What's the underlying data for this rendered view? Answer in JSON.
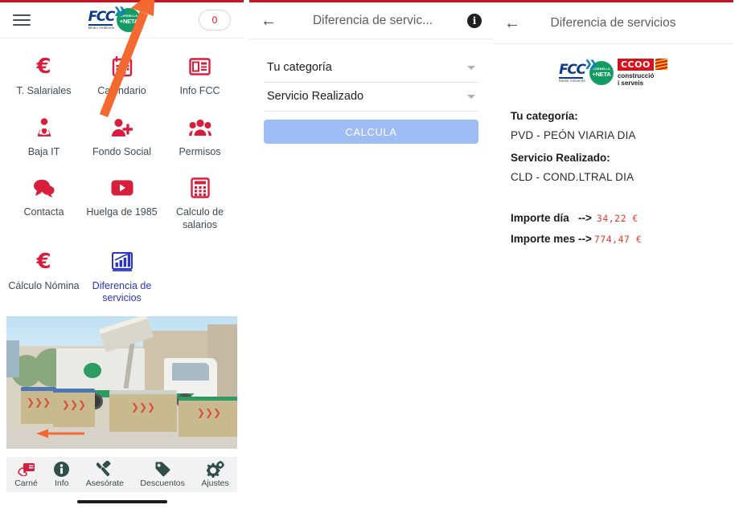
{
  "panel1": {
    "menu_icon": "hamburger-menu-icon",
    "logos": {
      "fcc_word": "FCC",
      "fcc_sub": "Medio Ambiente",
      "neta_top": "CORNELLÀ",
      "neta_bottom": "+NETA"
    },
    "badge_count": "0",
    "tiles": [
      {
        "label": "T. Salariales",
        "icon": "euro-icon",
        "glyph": "€",
        "highlight": false
      },
      {
        "label": "Calendario",
        "icon": "calendar-icon",
        "glyph": "▦",
        "highlight": false
      },
      {
        "label": "Info FCC",
        "icon": "newspaper-icon",
        "glyph": "▤",
        "highlight": false
      },
      {
        "label": "Baja IT",
        "icon": "doctor-icon",
        "glyph": "⚕",
        "highlight": false
      },
      {
        "label": "Fondo Social",
        "icon": "add-person-icon",
        "glyph": "👤",
        "highlight": false
      },
      {
        "label": "Permisos",
        "icon": "people-group-icon",
        "glyph": "👥",
        "highlight": false
      },
      {
        "label": "Contacta",
        "icon": "chat-bubbles-icon",
        "glyph": "💬",
        "highlight": false
      },
      {
        "label": "Huelga de 1985",
        "icon": "youtube-play-icon",
        "glyph": "▶",
        "highlight": false
      },
      {
        "label": "Calculo de salarios",
        "icon": "calculator-icon",
        "glyph": "▦",
        "highlight": false
      },
      {
        "label": "Cálculo Nómina",
        "icon": "euro-icon",
        "glyph": "€",
        "highlight": false
      },
      {
        "label": "Diferencia de servicios",
        "icon": "bar-chart-icon",
        "glyph": "📊",
        "highlight": true
      }
    ],
    "photo_alt": "garbage-truck-photo",
    "annotation_arrows": [
      "arrow-pointing-to-diferencia-de-servicios",
      "small-arrow"
    ],
    "bottom_nav": [
      {
        "label": "Carné",
        "icon": "id-card-hand-icon"
      },
      {
        "label": "Info",
        "icon": "info-circle-icon"
      },
      {
        "label": "Asesórate",
        "icon": "gavel-icon"
      },
      {
        "label": "Descuentos",
        "icon": "tag-icon"
      },
      {
        "label": "Ajustes",
        "icon": "gears-icon"
      }
    ]
  },
  "panel2": {
    "back_icon": "back-arrow-icon",
    "title": "Diferencia de servic...",
    "info_icon": "info-icon",
    "info_glyph": "i",
    "selects": [
      {
        "label": "Tu categoría",
        "name": "categoria-select"
      },
      {
        "label": "Servicio Realizado",
        "name": "servicio-select"
      }
    ],
    "calculate_button": "CALCULA"
  },
  "panel3": {
    "back_icon": "back-arrow-icon",
    "title": "Diferencia de servicios",
    "logos": {
      "fcc_word": "FCC",
      "fcc_sub": "Medio Ambiente",
      "neta_top": "CORNELLÀ",
      "neta_bottom": "+NETA",
      "ccoo_box": "CCOO",
      "ccoo_sub_line1": "construcció",
      "ccoo_sub_line2": "i serveis"
    },
    "results": {
      "categoria_label": "Tu categoría:",
      "categoria_value": "PVD - PEÓN VIARIA DIA",
      "servicio_label": "Servicio Realizado:",
      "servicio_value": "CLD - COND.LTRAL DIA",
      "importe_dia_label": "Importe día   -->",
      "importe_dia_value": "34,22 €",
      "importe_mes_label": "Importe mes -->",
      "importe_mes_value": "774,47 €"
    }
  },
  "colors": {
    "accent_red": "#cc1122",
    "icon_red": "#d81e3c",
    "highlight_blue": "#2a35c8",
    "button_blue": "#9fbdf5",
    "amount_red": "#e8392c",
    "nav_teal": "#2f4f4a",
    "arrow_orange": "#f4692f"
  }
}
